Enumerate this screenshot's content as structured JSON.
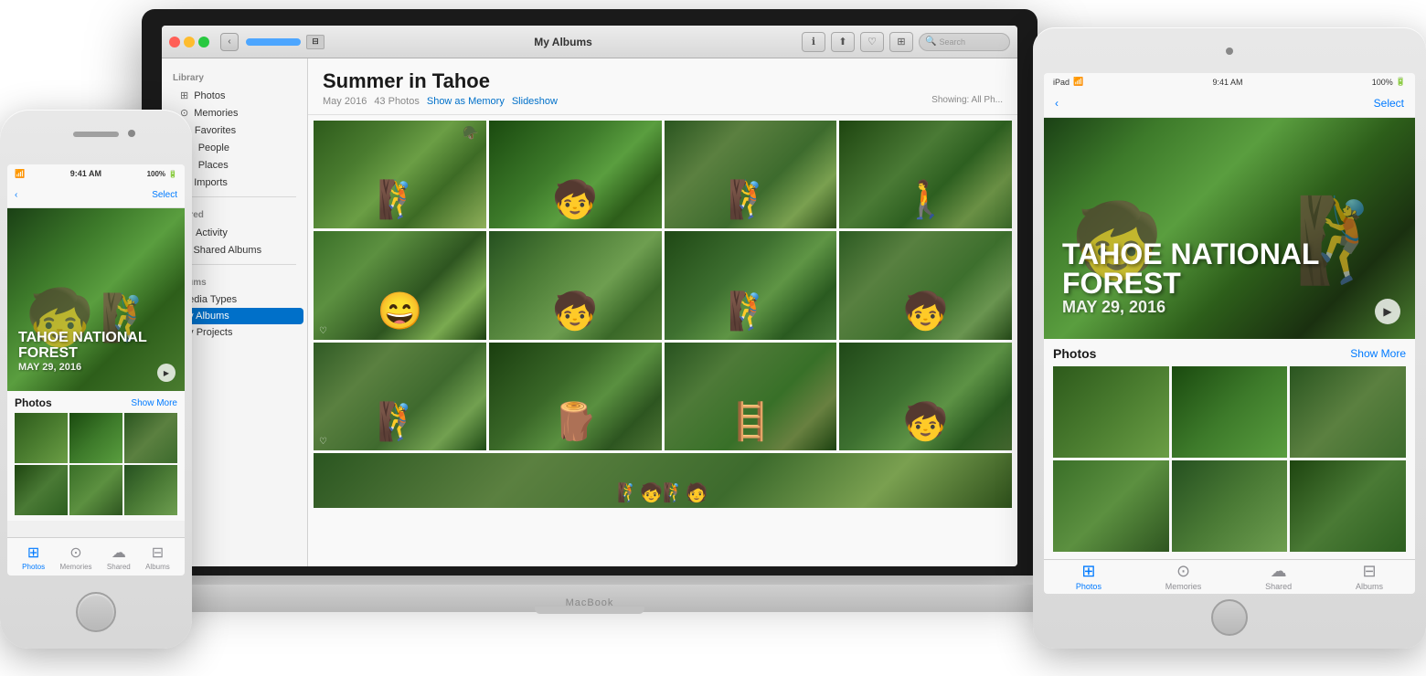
{
  "macbook": {
    "title": "My Albums",
    "album_title": "Summer in Tahoe",
    "album_meta": {
      "date": "May 2016",
      "photo_count": "43 Photos",
      "show_as_memory": "Show as Memory",
      "slideshow": "Slideshow",
      "showing": "Showing: All Ph..."
    },
    "toolbar": {
      "back_label": "‹",
      "title": "My Albums"
    },
    "sidebar": {
      "library_header": "Library",
      "library_items": [
        {
          "label": "Photos",
          "icon": "⊞"
        },
        {
          "label": "Memories",
          "icon": "⊙"
        },
        {
          "label": "Favorites",
          "icon": "♡"
        },
        {
          "label": "People",
          "icon": "👤"
        },
        {
          "label": "Places",
          "icon": "📍"
        },
        {
          "label": "Imports",
          "icon": "⊕"
        }
      ],
      "shared_header": "Shared",
      "shared_items": [
        {
          "label": "Activity",
          "icon": "☁"
        },
        {
          "label": "Shared Albums",
          "icon": "▶"
        }
      ],
      "albums_header": "Albums",
      "albums_items": [
        {
          "label": "Media Types"
        },
        {
          "label": "My Albums"
        },
        {
          "label": "My Projects"
        }
      ]
    }
  },
  "iphone": {
    "status": {
      "carrier": "📶",
      "time": "9:41 AM",
      "battery": "100%"
    },
    "nav": {
      "back": "‹",
      "select": "Select"
    },
    "hero": {
      "title": "TAHOE NATIONAL\nFOREST",
      "date": "MAY 29, 2016"
    },
    "photos_section": {
      "label": "Photos",
      "show_more": "Show More"
    },
    "tabbar": [
      {
        "label": "Photos",
        "icon": "⊞",
        "active": true
      },
      {
        "label": "Memories",
        "icon": "⊙"
      },
      {
        "label": "Shared",
        "icon": "☁"
      },
      {
        "label": "Albums",
        "icon": "⊟"
      }
    ]
  },
  "ipad": {
    "status": {
      "model": "iPad",
      "carrier": "📶",
      "time": "9:41 AM",
      "battery": "100%"
    },
    "nav": {
      "back": "‹",
      "select": "Select"
    },
    "hero": {
      "title": "TAHOE NATIONAL\nFOREST",
      "date": "MAY 29, 2016"
    },
    "photos_section": {
      "label": "Photos",
      "show_more": "Show More"
    },
    "tabbar": [
      {
        "label": "Photos",
        "icon": "⊞",
        "active": true
      },
      {
        "label": "Memories",
        "icon": "⊙"
      },
      {
        "label": "Shared",
        "icon": "☁"
      },
      {
        "label": "Albums",
        "icon": "⊟"
      }
    ]
  }
}
